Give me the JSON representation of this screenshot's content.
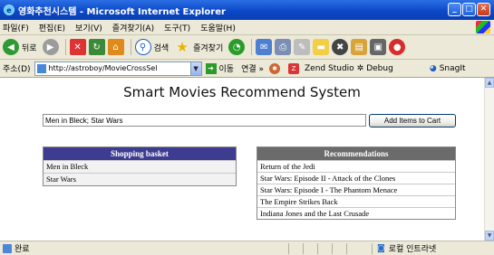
{
  "window": {
    "title": "영화추천시스템 - Microsoft Internet Explorer",
    "minimize": "_",
    "maximize": "□",
    "close": "✕"
  },
  "menu": [
    "파일(F)",
    "편집(E)",
    "보기(V)",
    "즐겨찾기(A)",
    "도구(T)",
    "도움말(H)"
  ],
  "toolbar": {
    "back_label": "뒤로",
    "search_label": "검색",
    "favorites_label": "즐겨찾기"
  },
  "address": {
    "label": "주소(D)",
    "url": "http://astroboy/MovieCrossSel",
    "go_label": "이동",
    "links_label": "연결 »",
    "zend_label": "Zend Studio",
    "debug_label": "Debug",
    "snagit_label": "SnagIt"
  },
  "page": {
    "title": "Smart Movies Recommend System",
    "movie_input_value": "Men in Bleck; Star Wars",
    "add_button_label": "Add Items to Cart",
    "basket": {
      "header": "Shopping basket",
      "items": [
        "Men in Bleck",
        "Star Wars"
      ]
    },
    "recommendations": {
      "header": "Recommendations",
      "items": [
        "Return of the Jedi",
        "Star Wars: Episode II - Attack of the Clones",
        "Star Wars: Episode I - The Phantom Menace",
        "The Empire Strikes Back",
        "Indiana Jones and the Last Crusade"
      ]
    }
  },
  "status": {
    "text": "완료",
    "zone": "로컬 인트라넷"
  },
  "colors": {
    "titlebar": "#0b49c9",
    "basket_header": "#3e3c91",
    "recs_header": "#6b6b6b"
  }
}
